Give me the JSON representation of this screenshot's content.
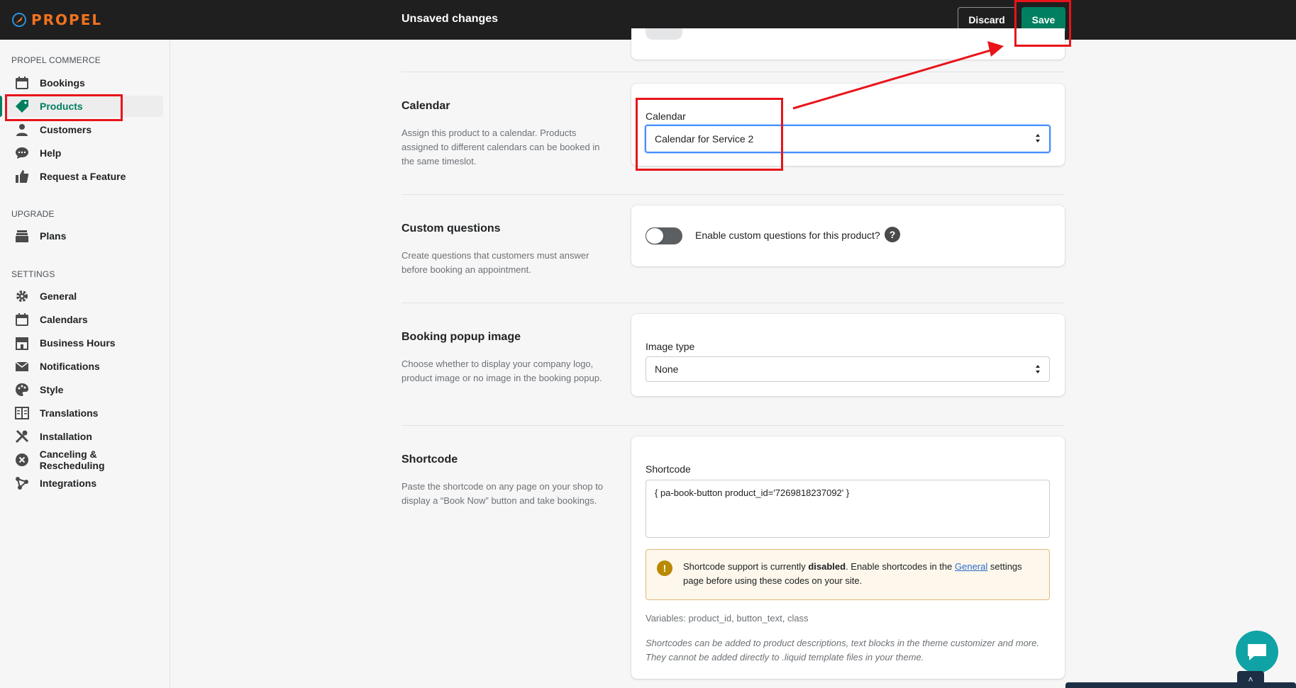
{
  "topbar": {
    "logo_text": "PROPEL",
    "title": "Unsaved changes",
    "discard_label": "Discard",
    "save_label": "Save"
  },
  "sidebar": {
    "sections": [
      {
        "label": "PROPEL COMMERCE"
      },
      {
        "label": "UPGRADE"
      },
      {
        "label": "SETTINGS"
      }
    ],
    "items": [
      {
        "label": "Bookings",
        "icon": "calendar-icon"
      },
      {
        "label": "Products",
        "icon": "tag-icon",
        "active": true
      },
      {
        "label": "Customers",
        "icon": "person-icon"
      },
      {
        "label": "Help",
        "icon": "chat-bubble-icon"
      },
      {
        "label": "Request a Feature",
        "icon": "thumbs-up-icon"
      },
      {
        "label": "Plans",
        "icon": "stack-icon"
      },
      {
        "label": "General",
        "icon": "gear-icon"
      },
      {
        "label": "Calendars",
        "icon": "calendar-icon"
      },
      {
        "label": "Business Hours",
        "icon": "store-icon"
      },
      {
        "label": "Notifications",
        "icon": "envelope-icon"
      },
      {
        "label": "Style",
        "icon": "palette-icon"
      },
      {
        "label": "Translations",
        "icon": "book-icon"
      },
      {
        "label": "Installation",
        "icon": "tools-icon"
      },
      {
        "label": "Canceling & Rescheduling",
        "icon": "cancel-circle-icon"
      },
      {
        "label": "Integrations",
        "icon": "connect-icon"
      }
    ]
  },
  "calendar": {
    "title": "Calendar",
    "description": "Assign this product to a calendar. Products assigned to different calendars can be booked in the same timeslot.",
    "field_label": "Calendar",
    "selected": "Calendar for Service 2"
  },
  "custom_questions": {
    "title": "Custom questions",
    "description": "Create questions that customers must answer before booking an appointment.",
    "toggle_label": "Enable custom questions for this product?",
    "help_glyph": "?"
  },
  "popup_image": {
    "title": "Booking popup image",
    "description": "Choose whether to display your company logo, product image or no image in the booking popup.",
    "field_label": "Image type",
    "selected": "None"
  },
  "shortcode": {
    "title": "Shortcode",
    "description": "Paste the shortcode on any page on your shop to display a “Book Now” button and take bookings.",
    "field_label": "Shortcode",
    "value": "{ pa-book-button product_id='7269818237092' }",
    "banner_icon_glyph": "!",
    "banner_text_1": "Shortcode support is currently ",
    "banner_bold": "disabled",
    "banner_text_2": ". Enable shortcodes in the ",
    "banner_link": "General",
    "banner_text_3": " settings page before using these codes on your site.",
    "variables": "Variables: product_id, button_text, class",
    "note": "Shortcodes can be added to product descriptions, text blocks in the theme customizer and more. They cannot be added directly to .liquid template files in your theme."
  },
  "colors": {
    "accent": "#008060",
    "brand": "#f0721f",
    "annotation": "#e8141a"
  },
  "footer": {
    "scroll_up_glyph": "˄"
  }
}
